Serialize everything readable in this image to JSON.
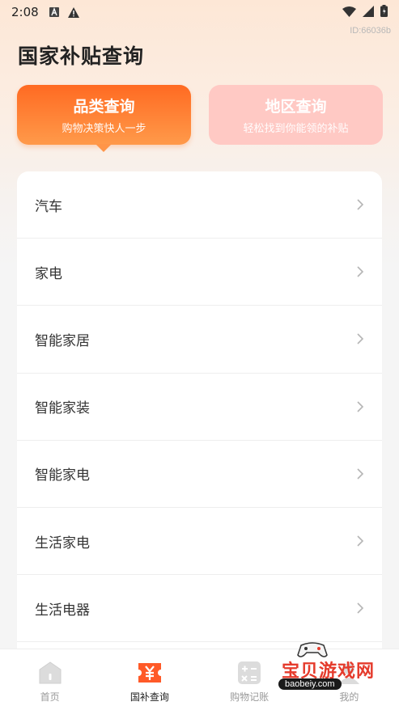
{
  "status_bar": {
    "time": "2:08"
  },
  "page": {
    "id_text": "ID:66036b",
    "title": "国家补贴查询"
  },
  "tabs": [
    {
      "title": "品类查询",
      "subtitle": "购物决策快人一步",
      "active": true
    },
    {
      "title": "地区查询",
      "subtitle": "轻松找到你能领的补贴",
      "active": false
    }
  ],
  "categories": [
    {
      "label": "汽车"
    },
    {
      "label": "家电"
    },
    {
      "label": "智能家居"
    },
    {
      "label": "智能家装"
    },
    {
      "label": "智能家电"
    },
    {
      "label": "生活家电"
    },
    {
      "label": "生活电器"
    }
  ],
  "bottom_nav": [
    {
      "label": "首页",
      "icon": "home-icon",
      "active": false
    },
    {
      "label": "国补查询",
      "icon": "yuan-ticket-icon",
      "active": true
    },
    {
      "label": "购物记账",
      "icon": "calculator-icon",
      "active": false
    },
    {
      "label": "我的",
      "icon": "profile-icon",
      "active": false
    }
  ],
  "watermark": {
    "text": "宝贝游戏网",
    "url": "baobeiy.com"
  },
  "colors": {
    "accent": "#ff6a22",
    "tab_inactive": "#ffc9c4",
    "watermark_red": "#e53b2c"
  }
}
